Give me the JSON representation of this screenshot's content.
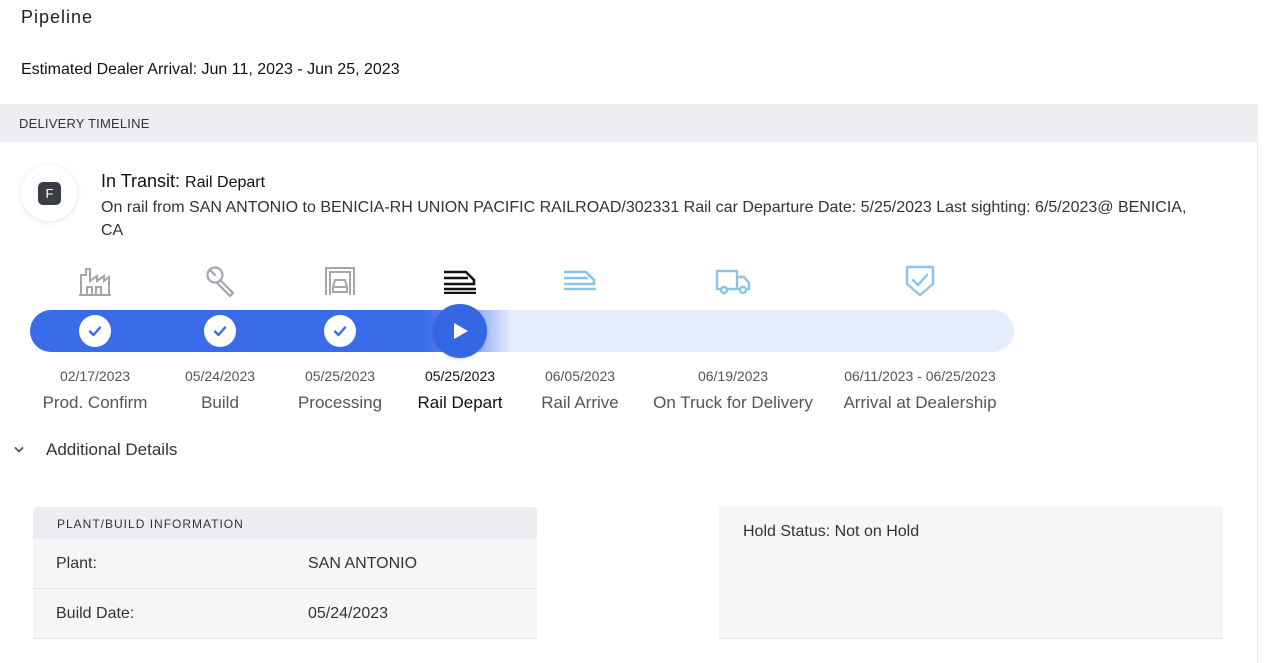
{
  "page": {
    "title": "Pipeline",
    "estimated_arrival": "Estimated Dealer Arrival: Jun 11, 2023 - Jun 25, 2023"
  },
  "delivery_timeline": {
    "section_title": "DELIVERY TIMELINE",
    "avatar_letter": "F",
    "status_label": "In Transit:",
    "status_value": "Rail Depart",
    "status_description": "On rail from SAN ANTONIO to BENICIA-RH UNION PACIFIC RAILROAD/302331 Rail car Departure Date: 5/25/2023 Last sighting: 6/5/2023@ BENICIA, CA",
    "progress_fraction": 0.49,
    "steps": [
      {
        "date": "02/17/2023",
        "label": "Prod. Confirm",
        "icon": "factory-icon",
        "state": "done"
      },
      {
        "date": "05/24/2023",
        "label": "Build",
        "icon": "wrench-icon",
        "state": "done"
      },
      {
        "date": "05/25/2023",
        "label": "Processing",
        "icon": "car-processing-icon",
        "state": "done"
      },
      {
        "date": "05/25/2023",
        "label": "Rail Depart",
        "icon": "rail-depart-icon",
        "state": "current"
      },
      {
        "date": "06/05/2023",
        "label": "Rail Arrive",
        "icon": "rail-arrive-icon",
        "state": "upcoming"
      },
      {
        "date": "06/19/2023",
        "label": "On Truck for Delivery",
        "icon": "truck-icon",
        "state": "upcoming"
      },
      {
        "date": "06/11/2023 - 06/25/2023",
        "label": "Arrival at Dealership",
        "icon": "shield-check-icon",
        "state": "upcoming"
      }
    ],
    "colors": {
      "accent": "#3467e4",
      "track_bg": "#e6edfc",
      "done_icon": "#a3a7ad",
      "upcoming_icon": "#8cc3e6",
      "current_icon": "#111111"
    }
  },
  "additional_details": {
    "toggle_label": "Additional Details",
    "plant_info": {
      "header": "PLANT/BUILD INFORMATION",
      "rows": [
        {
          "key": "Plant:",
          "value": "SAN ANTONIO"
        },
        {
          "key": "Build Date:",
          "value": "05/24/2023"
        }
      ]
    },
    "hold_status": "Hold Status: Not on Hold"
  }
}
